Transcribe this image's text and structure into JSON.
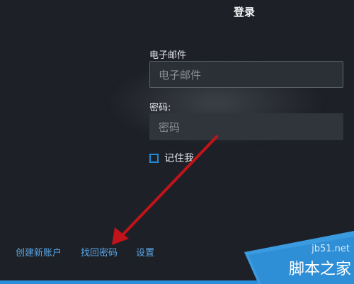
{
  "dialog": {
    "title": "登录",
    "email_label": "电子邮件",
    "email_placeholder": "电子邮件",
    "password_label": "密码:",
    "password_placeholder": "密码",
    "remember_me": "记住我"
  },
  "footer_links": [
    "创建新账户",
    "找回密码",
    "设置"
  ],
  "watermark": {
    "site": "jb51.net",
    "name": "脚本之家"
  },
  "colors": {
    "background": "#1d2026",
    "link": "#5aa6e6",
    "checkbox_border": "#1e8ad8",
    "annotation_arrow": "#c0141a"
  }
}
